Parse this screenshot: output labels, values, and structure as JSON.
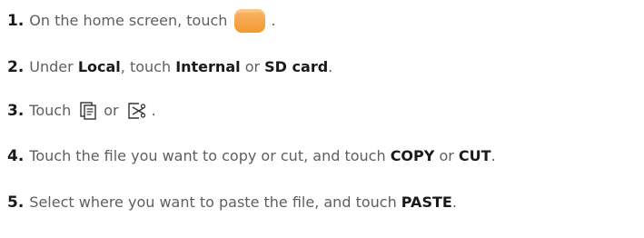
{
  "steps": [
    {
      "num": "1.",
      "text_before": "On the home screen, touch",
      "icon": "files-app-icon",
      "text_after": "."
    },
    {
      "num": "2.",
      "text_1": "Under",
      "bold_1": "Local",
      "text_2": ", touch",
      "bold_2": "Internal",
      "text_3": "or",
      "bold_3": "SD card",
      "text_4": "."
    },
    {
      "num": "3.",
      "text_1": "Touch",
      "icon_1": "copy-icon",
      "text_2": "or",
      "icon_2": "cut-icon",
      "text_3": "."
    },
    {
      "num": "4.",
      "text_1": "Touch the file you want to copy or cut, and touch",
      "bold_1": "COPY",
      "text_2": "or",
      "bold_2": "CUT",
      "text_3": "."
    },
    {
      "num": "5.",
      "text_1": "Select where you want to paste the file, and touch",
      "bold_1": "PASTE",
      "text_2": "."
    }
  ],
  "colors": {
    "text": "#5f5f5f",
    "emphasis": "#1a1a1a",
    "files_icon": "#f39a2e"
  }
}
